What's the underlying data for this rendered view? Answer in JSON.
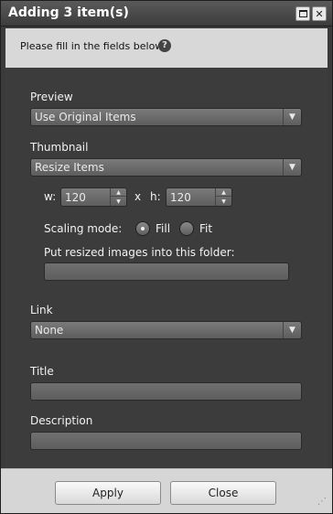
{
  "window": {
    "title": "Adding 3 item(s)"
  },
  "info": {
    "text": "Please fill in the fields below."
  },
  "preview": {
    "label": "Preview",
    "value": "Use Original Items"
  },
  "thumbnail": {
    "label": "Thumbnail",
    "value": "Resize Items",
    "width_label": "w:",
    "width_value": "120",
    "times": "x",
    "height_label": "h:",
    "height_value": "120",
    "scaling_label": "Scaling mode:",
    "scaling_options": [
      {
        "label": "Fill",
        "checked": true
      },
      {
        "label": "Fit",
        "checked": false
      }
    ],
    "folder_label": "Put resized images into this folder:",
    "folder_value": ""
  },
  "link": {
    "label": "Link",
    "value": "None"
  },
  "title_field": {
    "label": "Title",
    "value": ""
  },
  "description_field": {
    "label": "Description",
    "value": ""
  },
  "footer": {
    "apply_label": "Apply",
    "close_label": "Close"
  }
}
